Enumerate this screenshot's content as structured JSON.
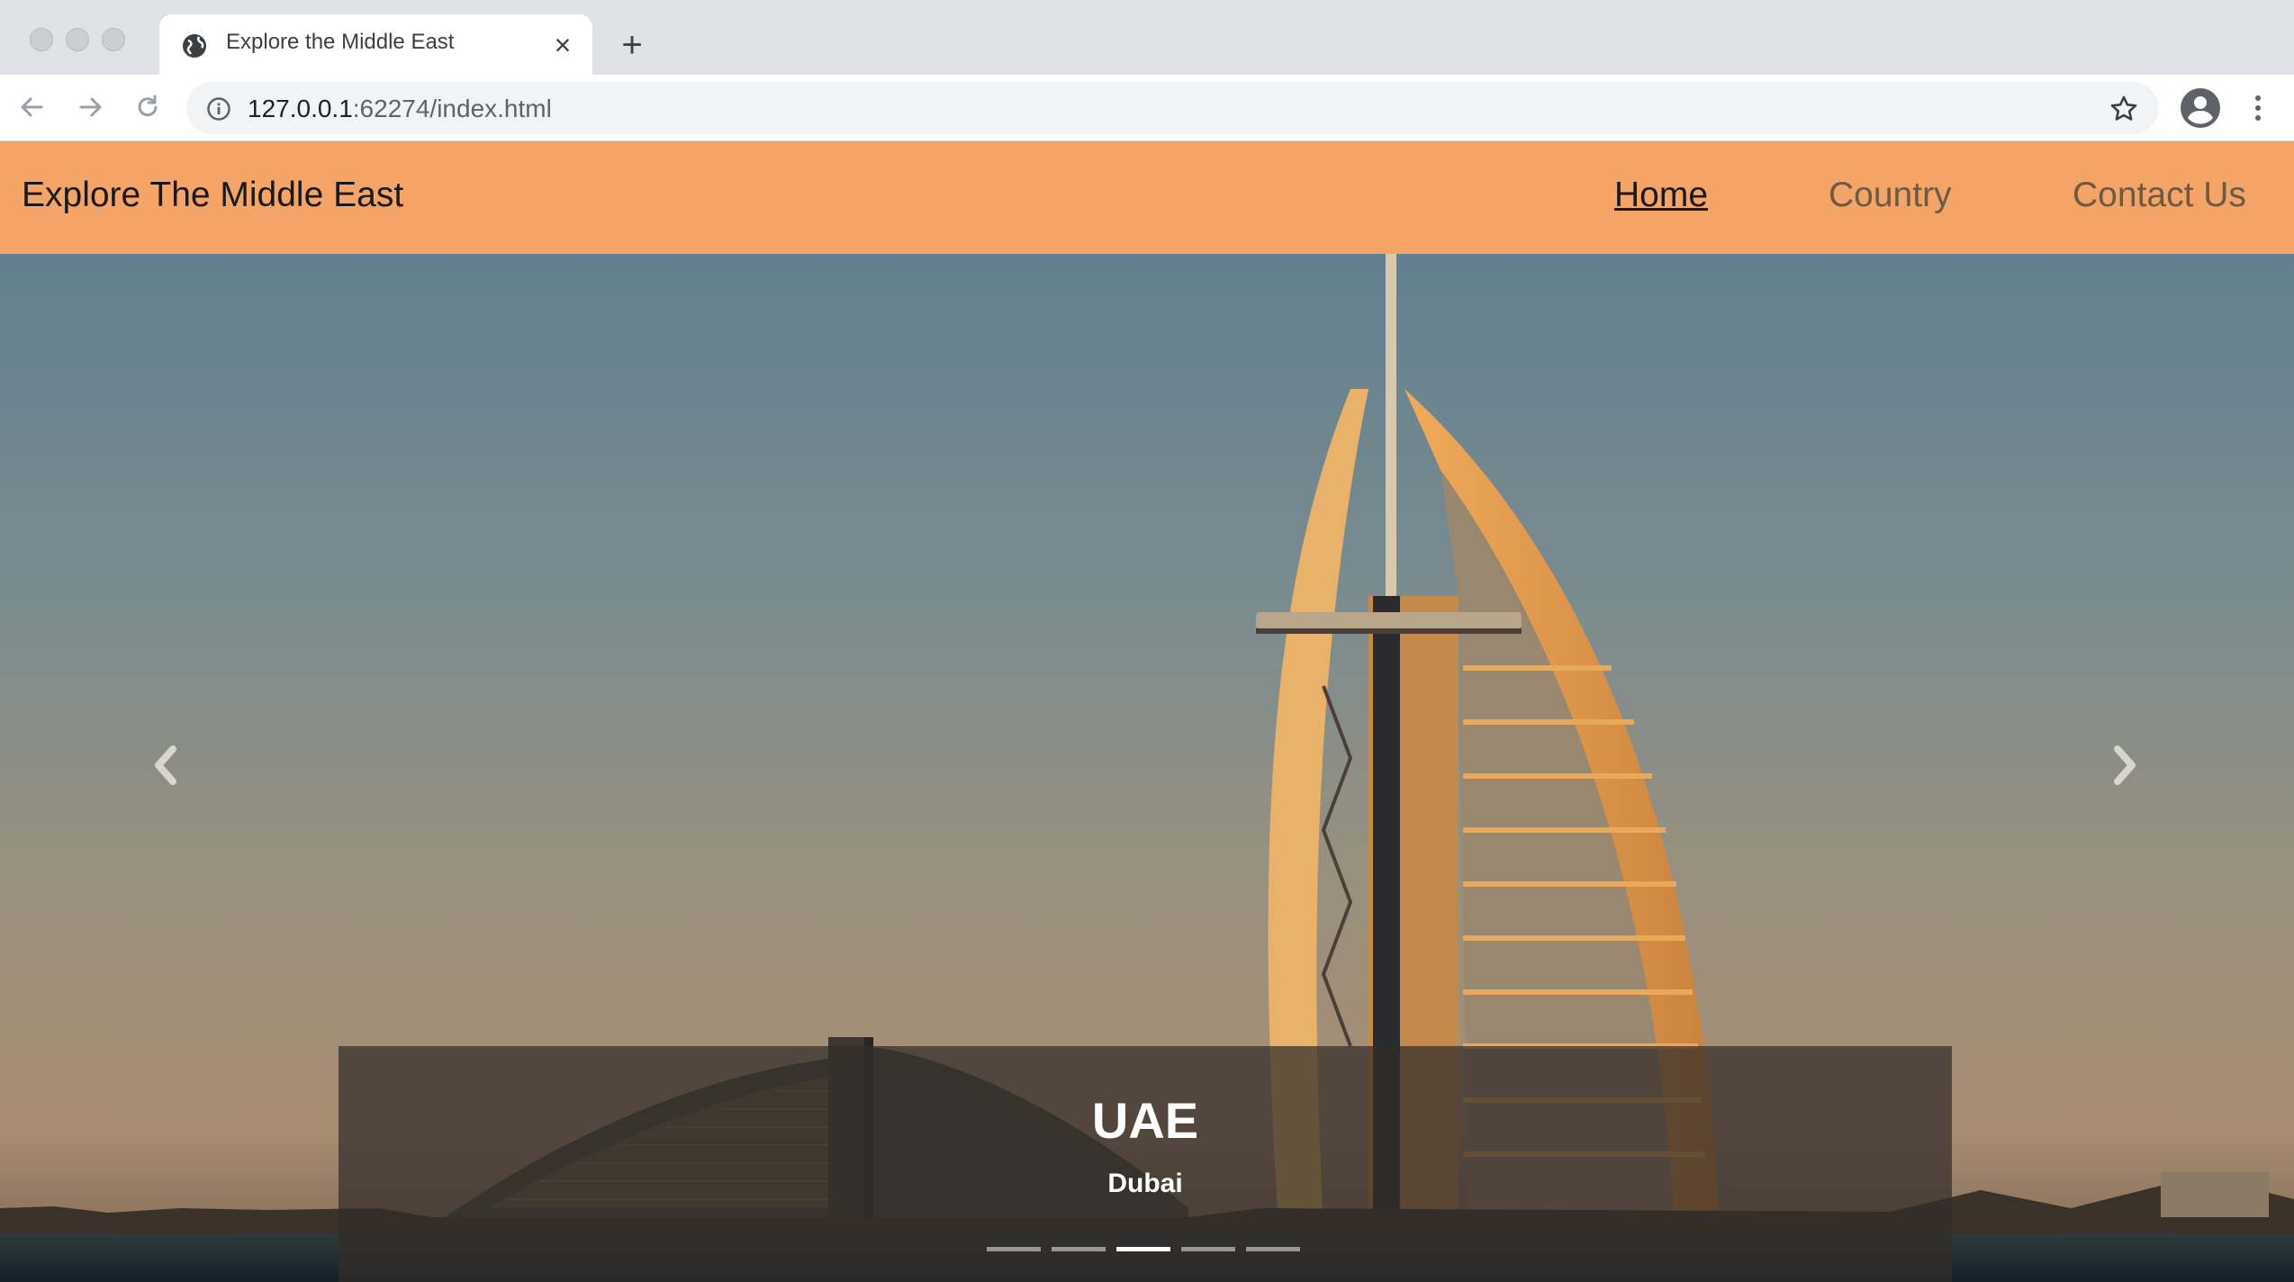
{
  "browser": {
    "tab_title": "Explore the Middle East",
    "url_host": "127.0.0.1",
    "url_rest": ":62274/index.html"
  },
  "navbar": {
    "brand": "Explore The Middle East",
    "links": [
      "Home",
      "Country",
      "Contact Us"
    ],
    "active": "Home"
  },
  "carousel": {
    "slide_count": 5,
    "active_index": 2,
    "caption_title": "UAE",
    "caption_subtitle": "Dubai"
  },
  "colors": {
    "navbar_bg": "#f4a466",
    "link_inactive": "#6e5945"
  }
}
